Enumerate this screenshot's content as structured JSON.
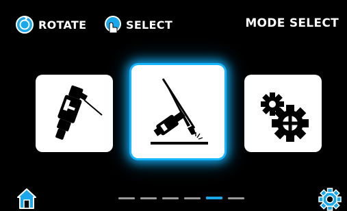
{
  "hints": {
    "rotate": {
      "label": "ROTATE",
      "icon": "rotate-knob-icon"
    },
    "select": {
      "label": "SELECT",
      "icon": "press-knob-icon"
    }
  },
  "title": "MODE SELECT",
  "modes": [
    {
      "name": "mig-torch",
      "icon": "mig-welding-torch-icon",
      "selected": false
    },
    {
      "name": "tig-torch",
      "icon": "tig-welding-torch-icon",
      "selected": true
    },
    {
      "name": "settings",
      "icon": "gears-icon",
      "selected": false
    }
  ],
  "pagination": {
    "pages": 6,
    "active_index": 4
  },
  "footer": {
    "home_icon": "home-icon",
    "settings_icon": "gear-icon"
  },
  "colors": {
    "accent": "#1aa8ea",
    "background": "#000000",
    "tile": "#ffffff"
  }
}
